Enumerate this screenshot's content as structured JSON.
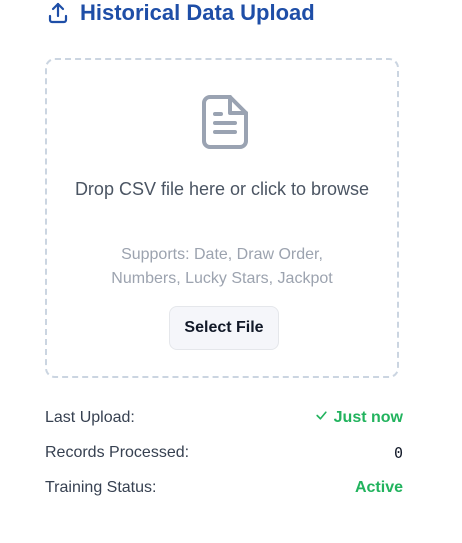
{
  "header": {
    "icon": "upload-icon",
    "title": "Historical Data Upload",
    "accent_color": "#1e4ea7"
  },
  "dropzone": {
    "icon": "file-text-icon",
    "instruction": "Drop CSV file here or click to browse",
    "supports": "Supports: Date, Draw Order, Numbers, Lucky Stars, Jackpot",
    "button_label": "Select File"
  },
  "stats": {
    "last_upload": {
      "label": "Last Upload:",
      "value": "Just now",
      "icon": "check-icon"
    },
    "records_processed": {
      "label": "Records Processed:",
      "value": "0"
    },
    "training_status": {
      "label": "Training Status:",
      "value": "Active"
    },
    "status_color": "#22b35e"
  }
}
